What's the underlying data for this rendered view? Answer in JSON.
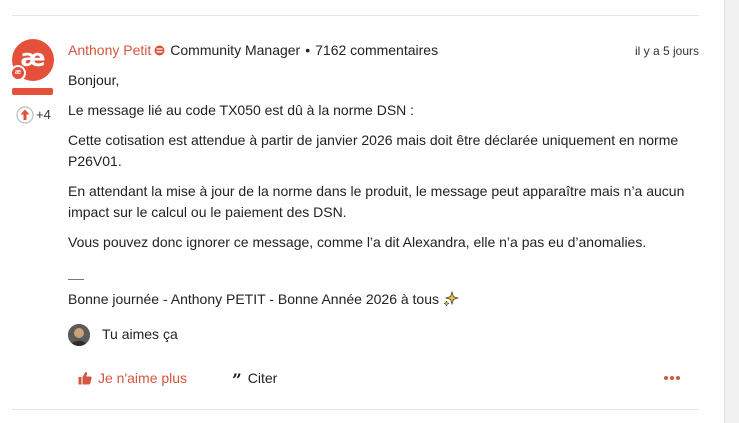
{
  "post": {
    "avatar_initials": "æ",
    "avatar_badge": "æ",
    "vote_count": "+4",
    "author": "Anthony Petit",
    "role": "Community Manager",
    "separator": "•",
    "comment_count": "7162 commentaires",
    "timestamp": "il y a 5 jours",
    "paragraphs": [
      "Bonjour,",
      "Le message lié au code TX050 est dû à la norme DSN :",
      "Cette cotisation est attendue à partir de janvier 2026 mais doit être déclarée uniquement en norme P26V01.",
      "En attendant la mise à jour de la norme dans le produit, le message peut apparaître mais n’a aucun impact sur le calcul ou le paiement des DSN.",
      "Vous pouvez donc ignorer ce message, comme l’a dit Alexandra, elle n’a pas eu d’anomalies."
    ],
    "signature": "Bonne journée - Anthony PETIT - Bonne Année 2026 à tous",
    "likes_text": "Tu aimes ça"
  },
  "actions": {
    "unlike_label": "Je n'aime plus",
    "quote_label": "Citer",
    "more_icon": "ellipsis-icon"
  },
  "colors": {
    "brand": "#e4503a",
    "author_link": "#d5563f",
    "text": "#222222"
  }
}
